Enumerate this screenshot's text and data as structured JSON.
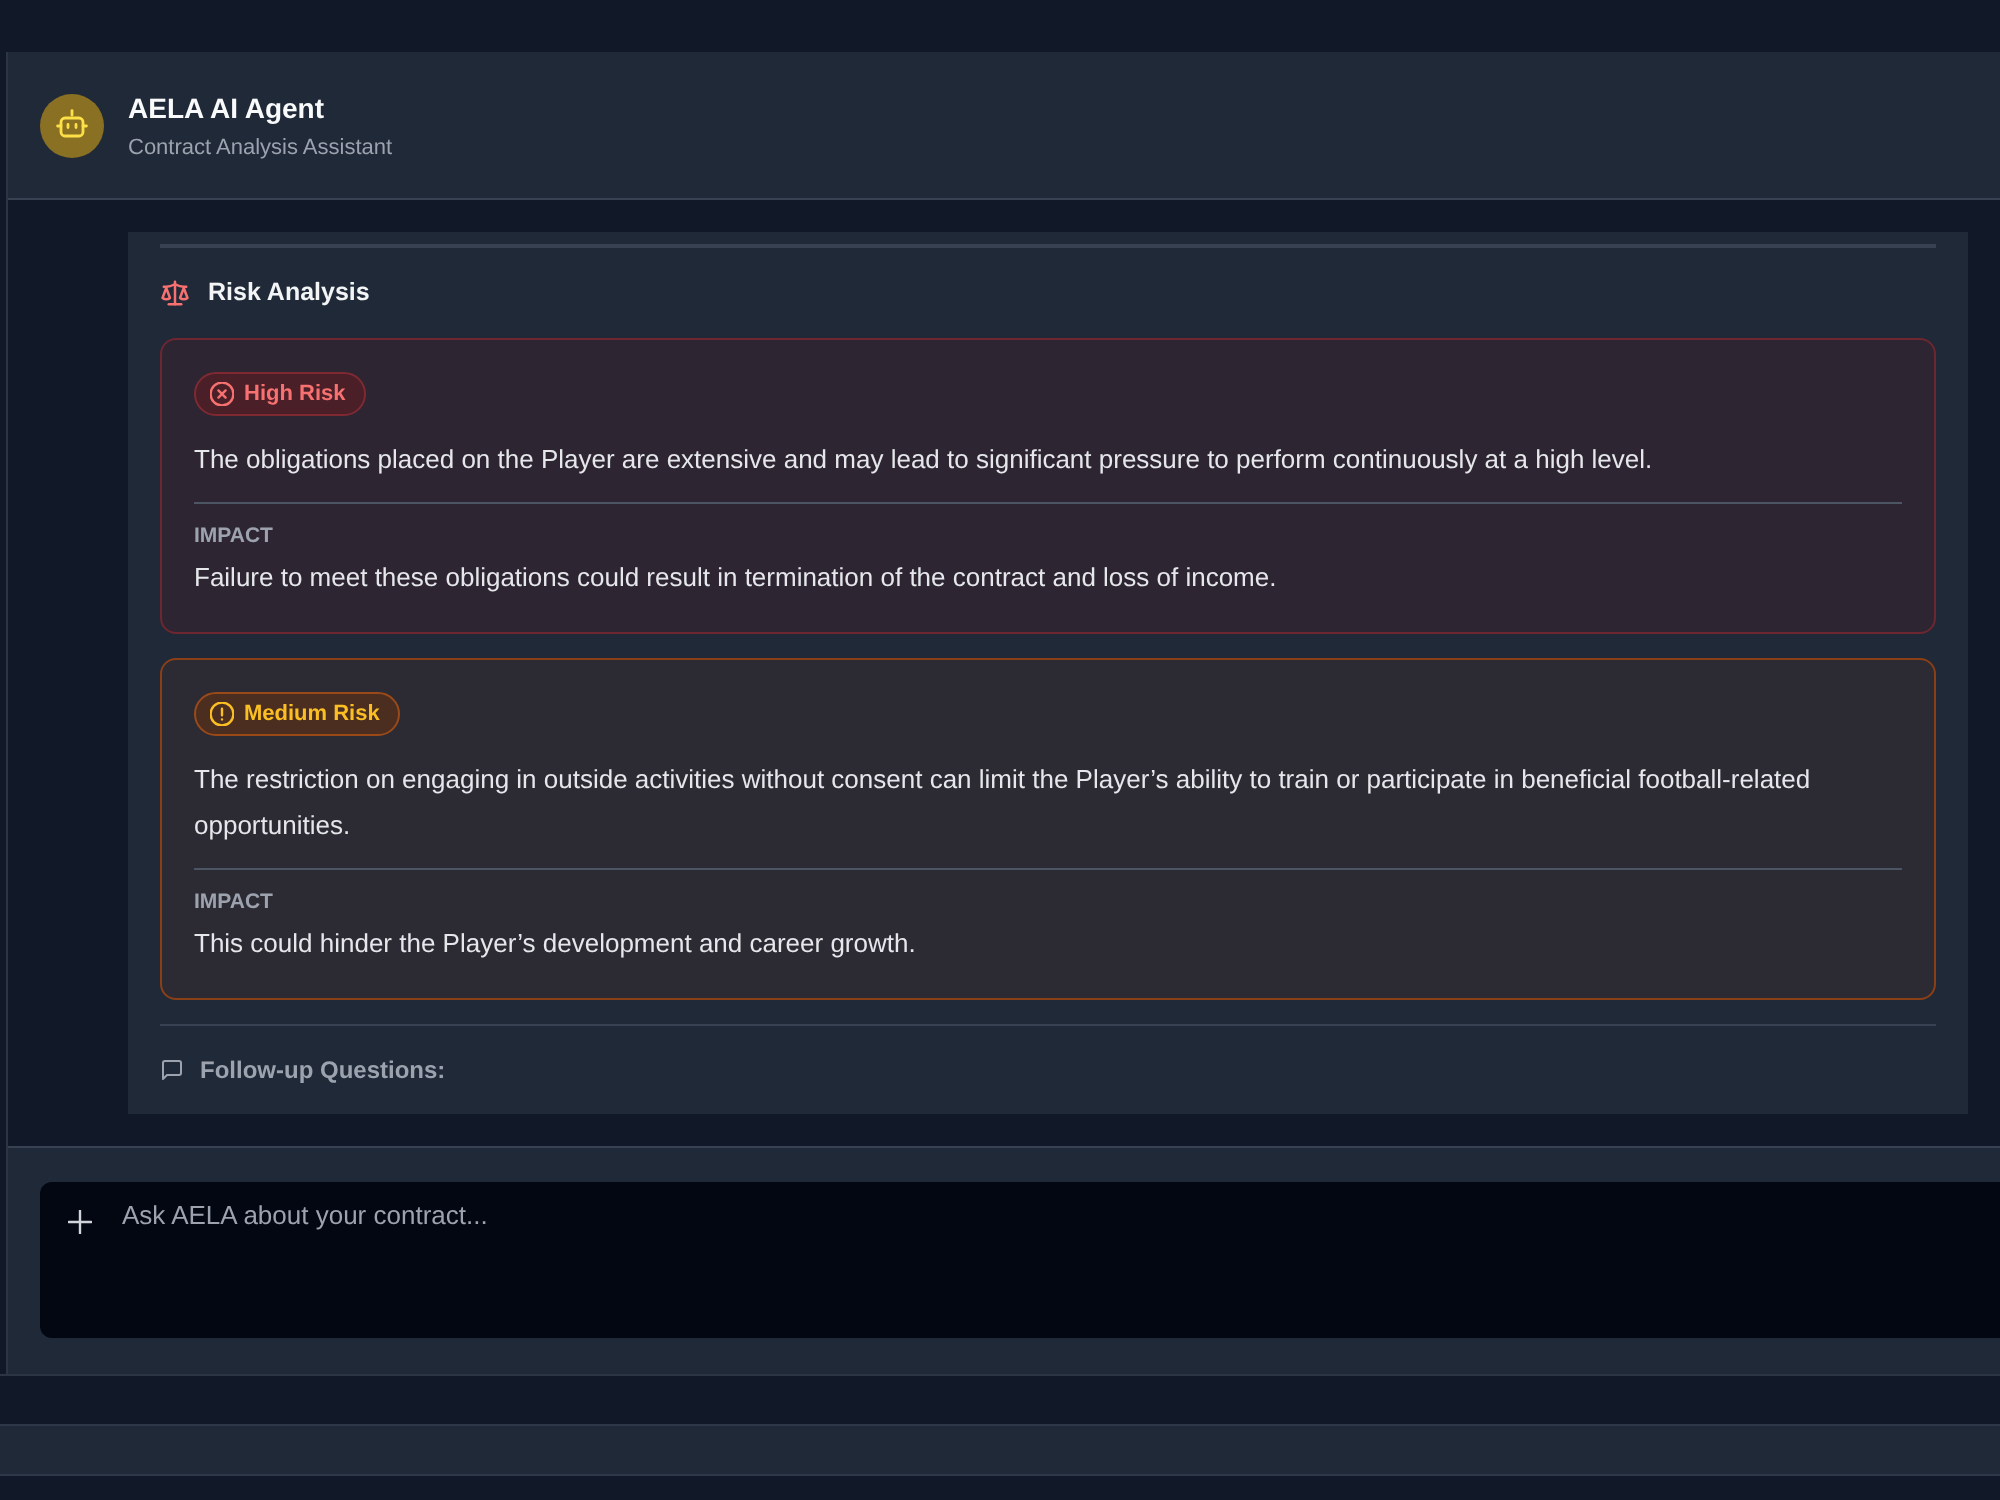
{
  "header": {
    "title": "AELA AI Agent",
    "subtitle": "Contract Analysis Assistant"
  },
  "message": {
    "section_title": "Risk Analysis",
    "risks": [
      {
        "kind": "high",
        "badge": "High Risk",
        "description": "The obligations placed on the Player are extensive and may lead to significant pressure to perform continuously at a high level.",
        "impact_label": "IMPACT",
        "impact": "Failure to meet these obligations could result in termination of the contract and loss of income."
      },
      {
        "kind": "medium",
        "badge": "Medium Risk",
        "description": "The restriction on engaging in outside activities without consent can limit the Player’s ability to train or participate in beneficial football-related opportunities.",
        "impact_label": "IMPACT",
        "impact": "This could hinder the Player’s development and career growth."
      }
    ],
    "follow_up_title": "Follow-up Questions:"
  },
  "composer": {
    "placeholder": "Ask AELA about your contract..."
  }
}
